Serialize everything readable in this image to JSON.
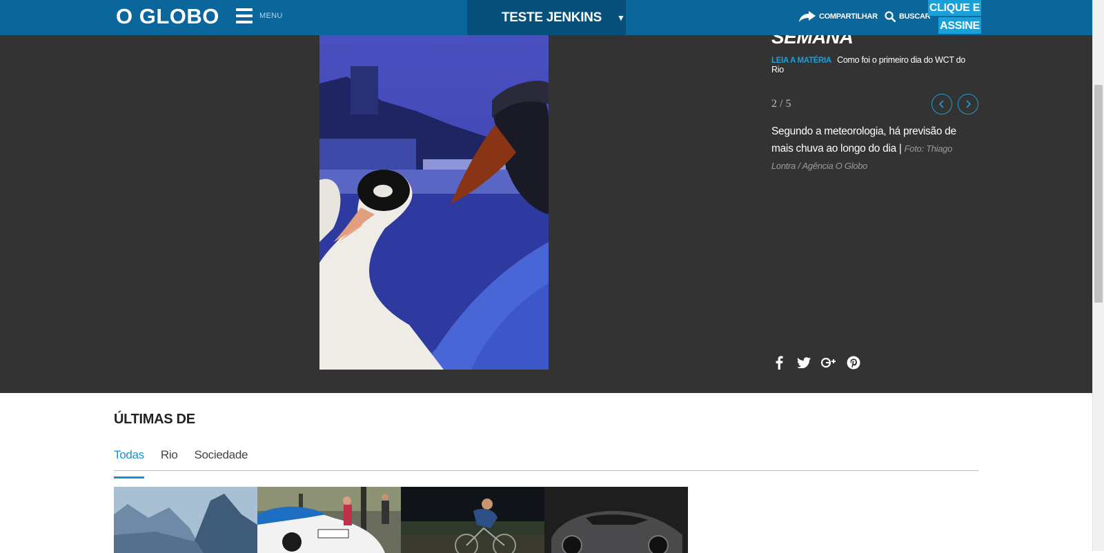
{
  "header": {
    "logo": "O GLOBO",
    "menu_label": "MENU",
    "section_title": "TESTE JENKINS",
    "share_label": "COMPARTILHAR",
    "search_label": "BUSCAR",
    "cta_line1": "CLIQUE E",
    "cta_line2": "ASSINE",
    "colors": {
      "bar": "#0a669b",
      "section_bg": "#08507c",
      "accent": "#1aa0d8"
    }
  },
  "gallery": {
    "title": "SEMANA",
    "read_more_tag": "LEIA A MATÉRIA",
    "read_more_link": "Como foi o primeiro dia do WCT do Rio",
    "counter": "2 / 5",
    "caption": "Segundo a meteorologia, há previsão de mais chuva ao longo do dia | ",
    "credit": "Foto: Thiago Lontra / Agência O Globo",
    "social_icons": [
      "facebook-icon",
      "twitter-icon",
      "google-plus-icon",
      "pinterest-icon"
    ],
    "background": "#333333"
  },
  "latest": {
    "title": "ÚLTIMAS DE",
    "tabs": [
      {
        "label": "Todas",
        "active": true
      },
      {
        "label": "Rio",
        "active": false
      },
      {
        "label": "Sociedade",
        "active": false
      }
    ],
    "thumbnails": [
      "mountains-photo",
      "police-car-photo",
      "cyclist-photo",
      "car-photo"
    ]
  }
}
